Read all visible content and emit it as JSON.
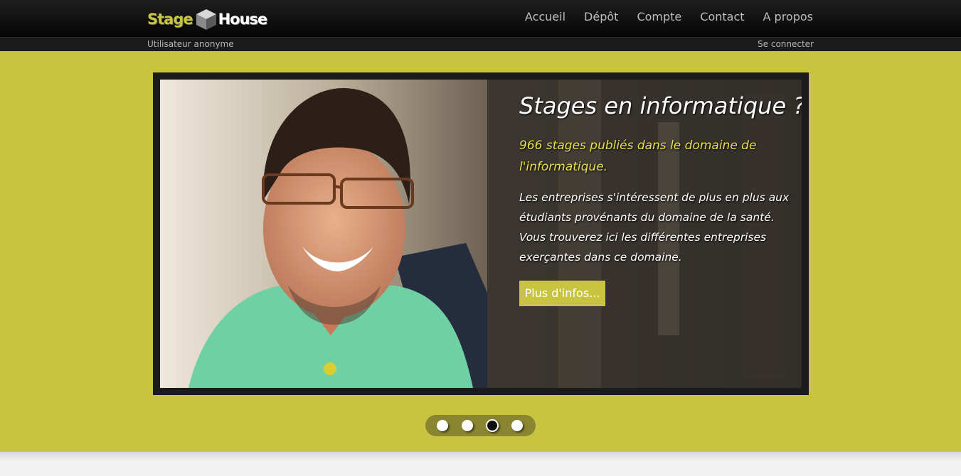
{
  "brand": {
    "part1": "Stage",
    "part2": "House",
    "icon": "cube-icon"
  },
  "nav": [
    {
      "label": "Accueil"
    },
    {
      "label": "Dépôt"
    },
    {
      "label": "Compte"
    },
    {
      "label": "Contact"
    },
    {
      "label": "A propos"
    }
  ],
  "subbar": {
    "user": "Utilisateur anonyme",
    "login": "Se connecter"
  },
  "slide": {
    "title": "Stages en informatique ?",
    "subtitle": "966 stages publiés dans le domaine de l'informatique.",
    "body": "Les entreprises s'intéressent de plus en plus aux étudiants provénants du domaine de la santé. Vous trouverez ici les différentes entreprises exerçantes dans ce domaine.",
    "button": "Plus d'infos..."
  },
  "carousel": {
    "slide_count": 4,
    "active_index": 3
  },
  "colors": {
    "accent": "#c8c440",
    "topbar": "#0a0a0a",
    "subtitle": "#e6e04a"
  }
}
